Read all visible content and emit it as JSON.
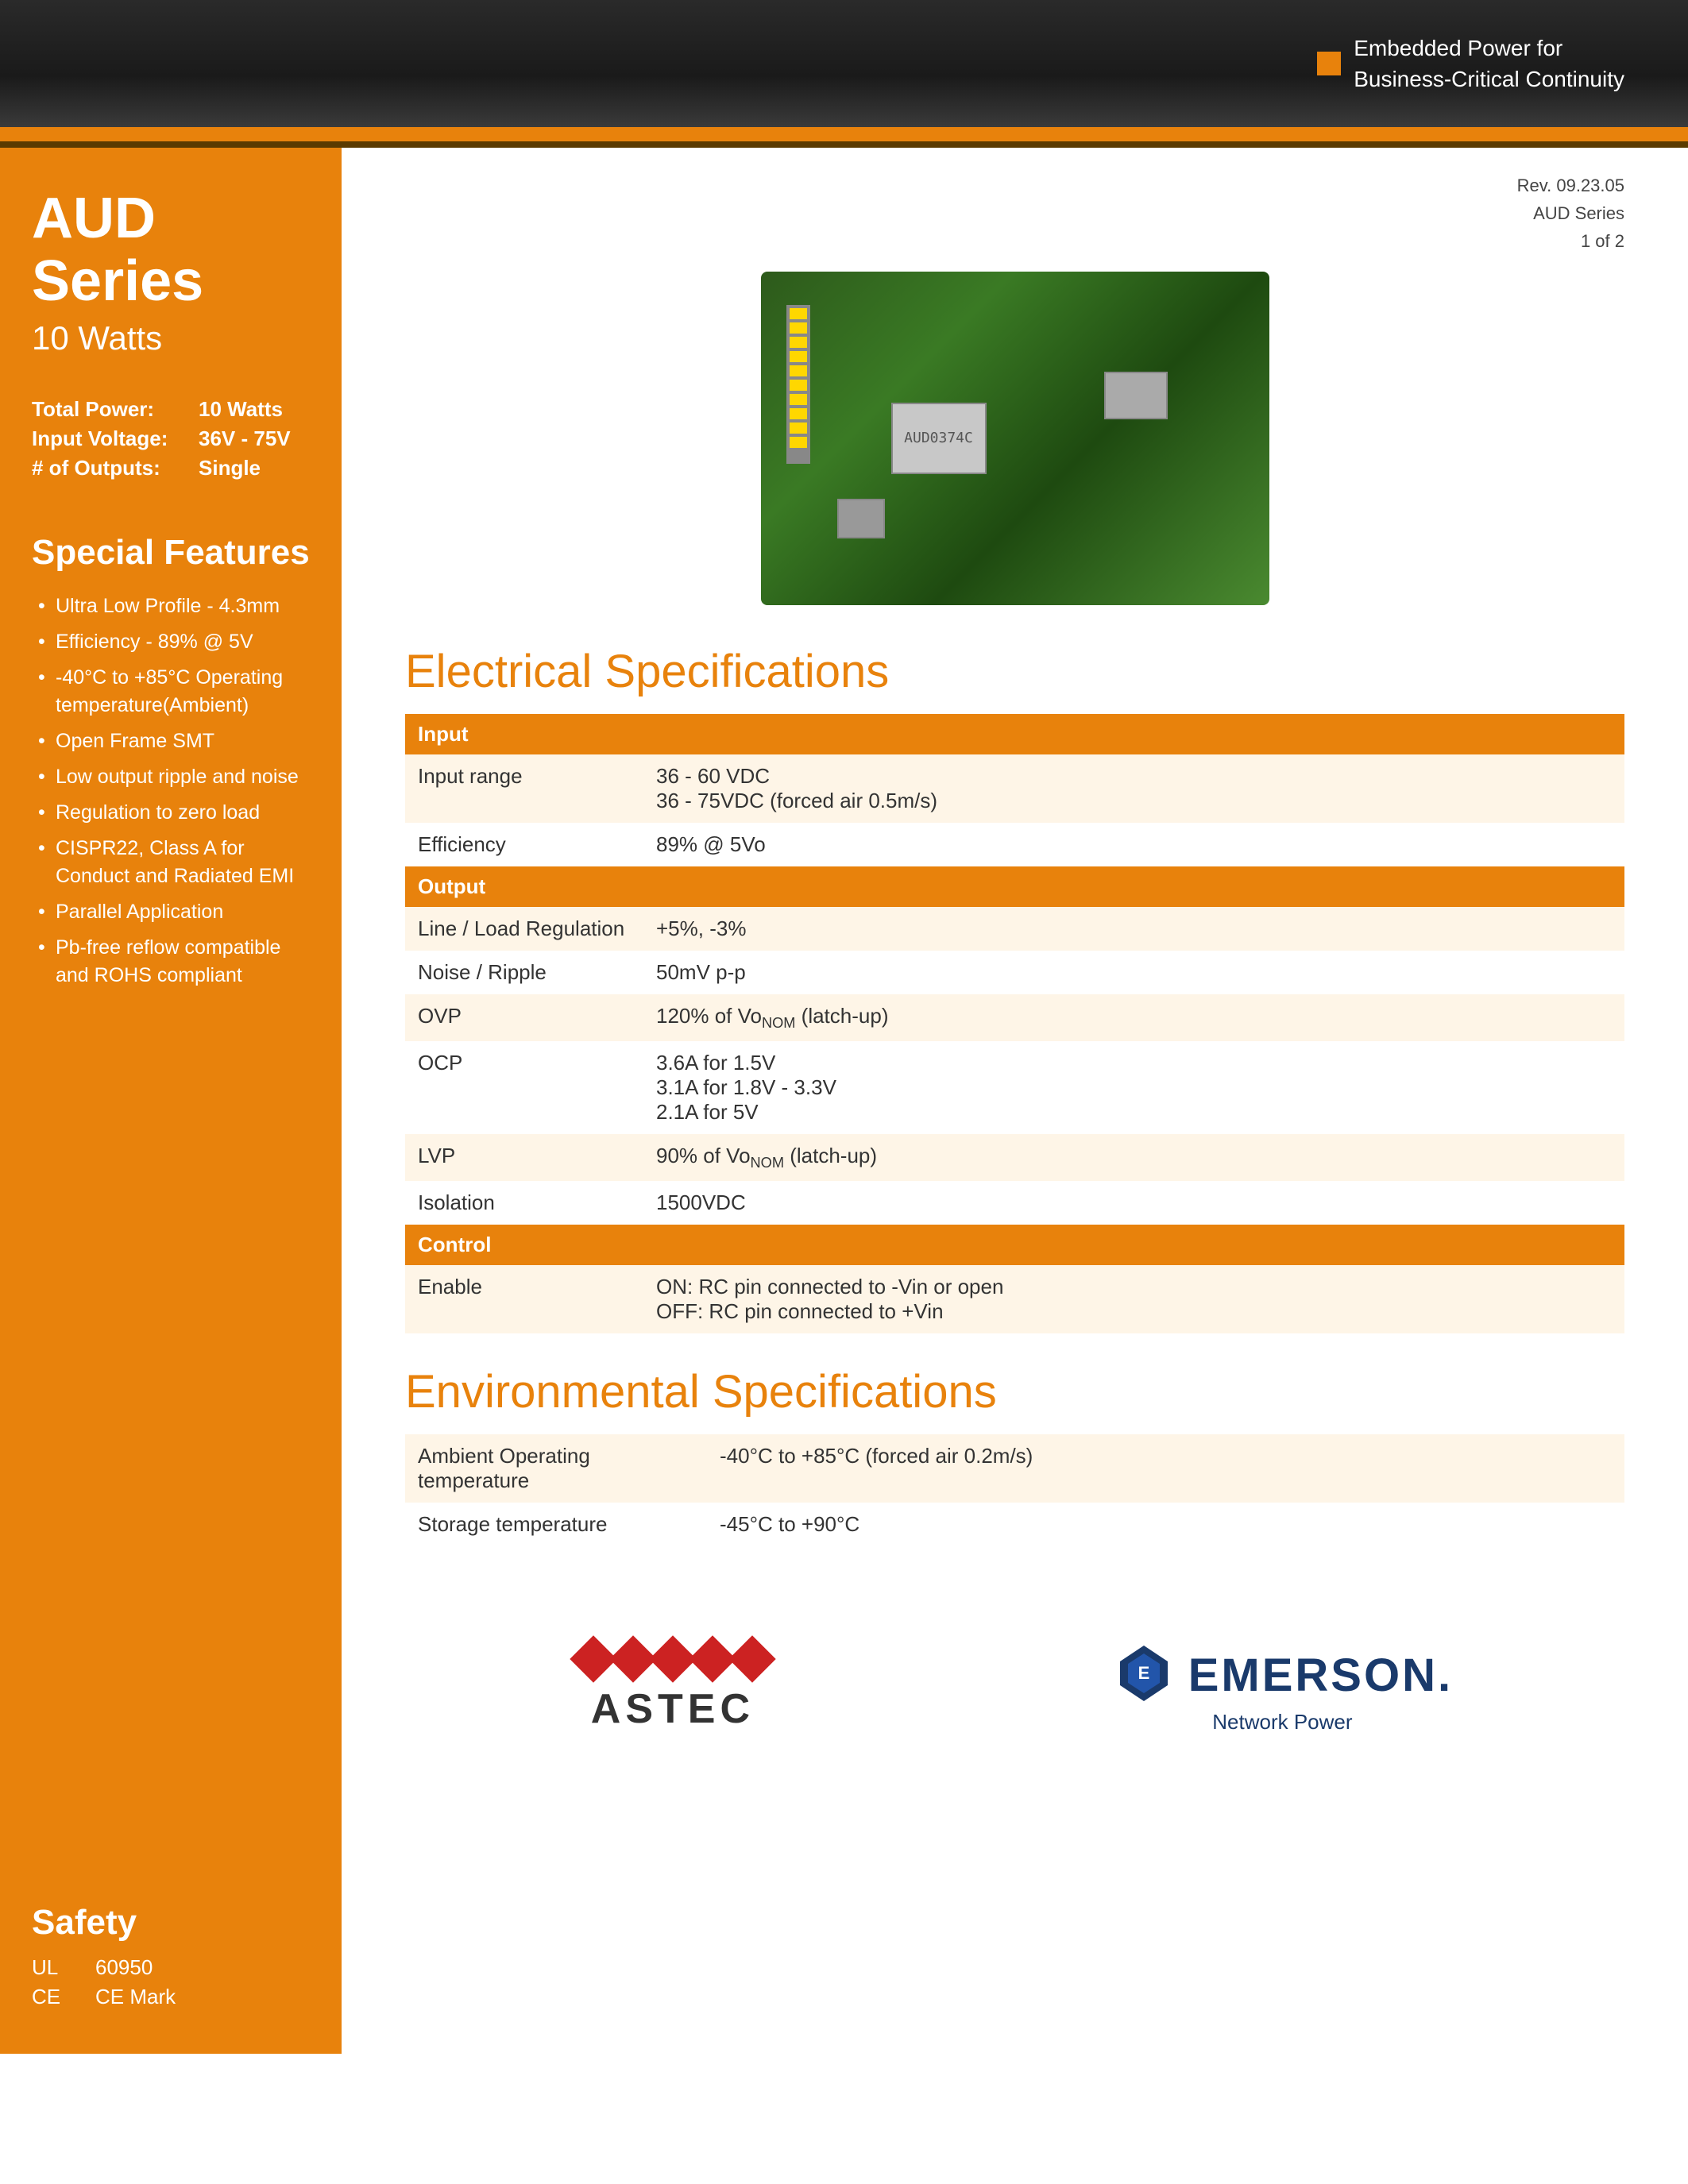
{
  "header": {
    "brand_line1": "Embedded Power for",
    "brand_line2": "Business-Critical Continuity"
  },
  "rev_info": {
    "line1": "Rev. 09.23.05",
    "line2": "AUD Series",
    "line3": "1 of 2"
  },
  "sidebar": {
    "series_title": "AUD Series",
    "series_watts": "10 Watts",
    "specs": [
      {
        "label": "Total Power:",
        "value": "10 Watts"
      },
      {
        "label": "Input Voltage:",
        "value": "36V - 75V"
      },
      {
        "label": "# of Outputs:",
        "value": "Single"
      }
    ],
    "features_title": "Special Features",
    "features": [
      "Ultra Low Profile - 4.3mm",
      "Efficiency - 89% @ 5V",
      "-40°C to +85°C Operating temperature(Ambient)",
      "Open Frame SMT",
      "Low output ripple and noise",
      "Regulation to zero load",
      "CISPR22, Class A for Conduct and Radiated EMI",
      "Parallel Application",
      "Pb-free reflow compatible and ROHS compliant"
    ],
    "safety_title": "Safety",
    "safety_items": [
      {
        "label": "UL",
        "value": "60950"
      },
      {
        "label": "CE",
        "value": "CE Mark"
      }
    ]
  },
  "electrical_specs": {
    "section_title": "Electrical Specifications",
    "input_header": "Input",
    "input_rows": [
      {
        "label": "Input range",
        "value_line1": "36 - 60 VDC",
        "value_line2": "36 - 75VDC (forced air 0.5m/s)"
      },
      {
        "label": "Efficiency",
        "value_line1": "89% @ 5Vo",
        "value_line2": ""
      }
    ],
    "output_header": "Output",
    "output_rows": [
      {
        "label": "Line / Load Regulation",
        "value": "+5%, -3%"
      },
      {
        "label": "Noise / Ripple",
        "value": "50mV p-p"
      },
      {
        "label": "OVP",
        "value": "120% of VoNOM (latch-up)"
      },
      {
        "label": "OCP",
        "value_line1": "3.6A for 1.5V",
        "value_line2": "3.1A for 1.8V - 3.3V",
        "value_line3": "2.1A for 5V"
      },
      {
        "label": "LVP",
        "value": "90% of VoNOM (latch-up)"
      },
      {
        "label": "Isolation",
        "value": "1500VDC"
      }
    ],
    "control_header": "Control",
    "control_rows": [
      {
        "label": "Enable",
        "value_line1": "ON: RC pin connected to -Vin or open",
        "value_line2": "OFF: RC pin connected to +Vin"
      }
    ]
  },
  "environmental_specs": {
    "section_title": "Environmental Specifications",
    "rows": [
      {
        "label": "Ambient Operating temperature",
        "value": "-40°C to +85°C (forced air 0.2m/s)"
      },
      {
        "label": "Storage temperature",
        "value": "-45°C to +90°C"
      }
    ]
  },
  "footer": {
    "astec_text": "ASTEC",
    "emerson_name": "EMERSON.",
    "emerson_sub": "Network Power"
  }
}
